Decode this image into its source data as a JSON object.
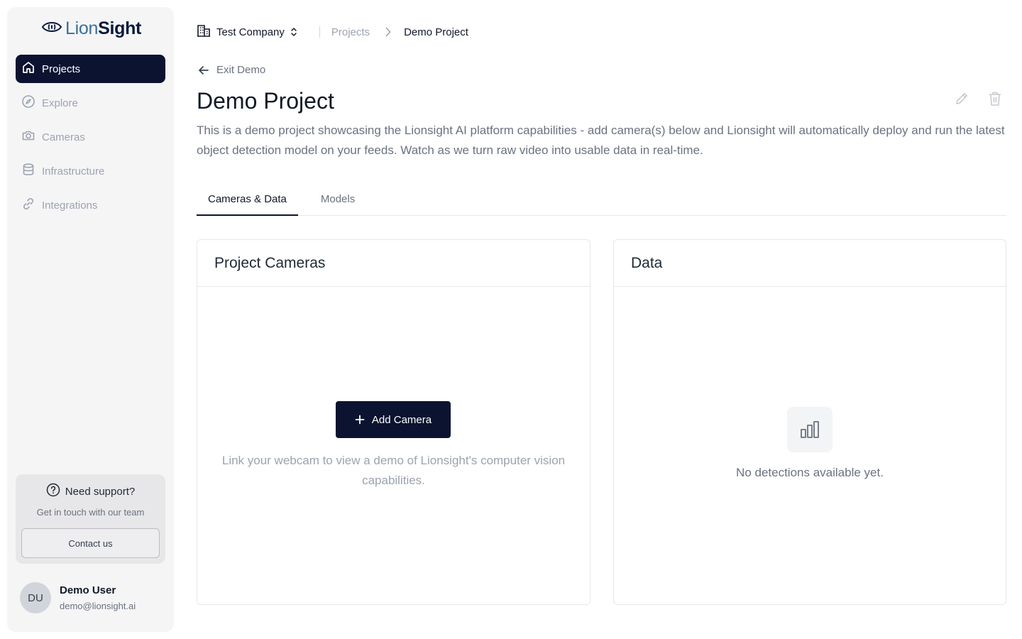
{
  "brand": {
    "logo_part1": "Lion",
    "logo_part2": "Sight",
    "logo_icon": "eye-icon"
  },
  "sidebar": {
    "items": [
      {
        "label": "Projects",
        "icon": "home-icon",
        "active": true
      },
      {
        "label": "Explore",
        "icon": "compass-icon",
        "active": false
      },
      {
        "label": "Cameras",
        "icon": "camera-icon",
        "active": false
      },
      {
        "label": "Infrastructure",
        "icon": "database-icon",
        "active": false
      },
      {
        "label": "Integrations",
        "icon": "link-icon",
        "active": false
      }
    ],
    "support": {
      "title": "Need support?",
      "subtitle": "Get in touch with our team",
      "button": "Contact us",
      "icon": "question-circle-icon"
    },
    "user": {
      "initials": "DU",
      "name": "Demo User",
      "email": "demo@lionsight.ai"
    }
  },
  "header": {
    "company": "Test Company",
    "company_icon": "building-icon",
    "breadcrumb": [
      "Projects",
      "Demo Project"
    ]
  },
  "page": {
    "exit_label": "Exit Demo",
    "title": "Demo Project",
    "description": "This is a demo project showcasing the Lionsight AI platform capabilities - add camera(s) below and Lionsight will automatically deploy and run the latest object detection model on your feeds. Watch as we turn raw video into usable data in real-time.",
    "tabs": [
      {
        "label": "Cameras & Data",
        "active": true
      },
      {
        "label": "Models",
        "active": false
      }
    ]
  },
  "cameras_card": {
    "title": "Project Cameras",
    "add_button": "Add Camera",
    "note": "Link your webcam to view a demo of Lionsight's computer vision capabilities."
  },
  "data_card": {
    "title": "Data",
    "empty_text": "No detections available yet.",
    "empty_icon": "bar-chart-icon"
  },
  "colors": {
    "primary": "#0b1330",
    "brand_blue": "#3b6f96",
    "muted": "#9ca3af"
  }
}
